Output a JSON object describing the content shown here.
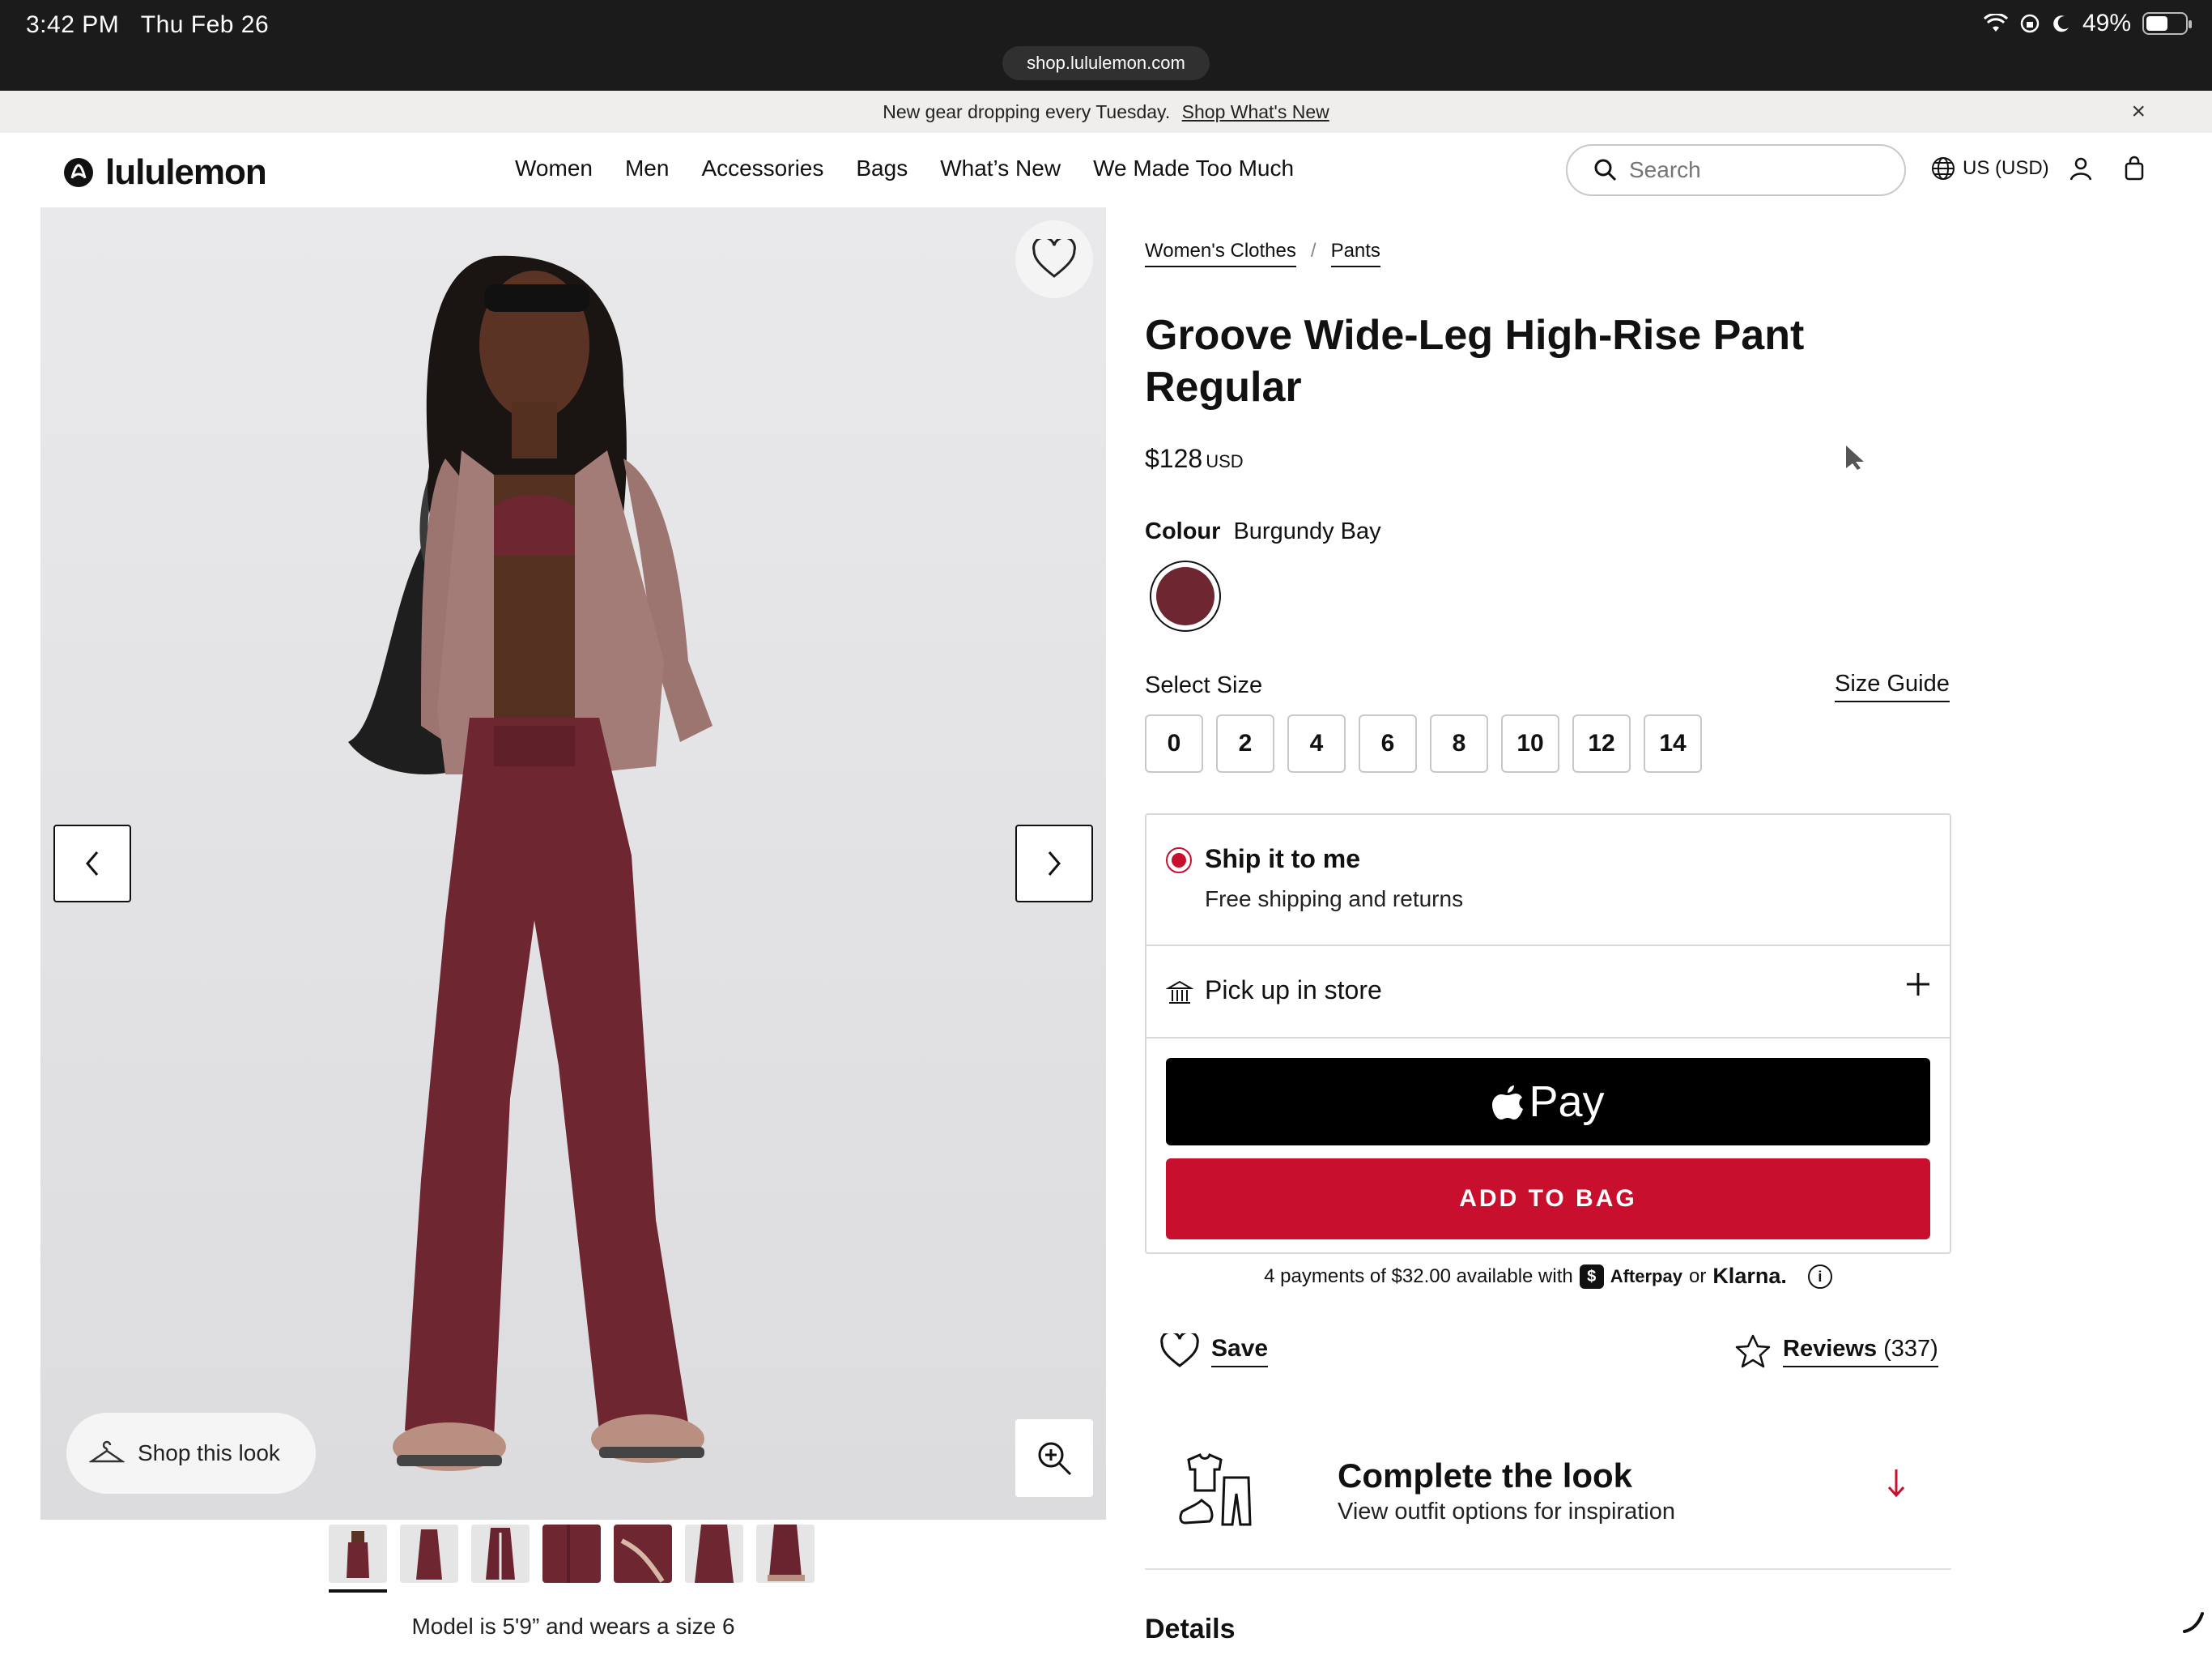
{
  "status_bar": {
    "time": "3:42 PM",
    "date": "Thu Feb 26",
    "battery": "49%",
    "url": "shop.lululemon.com"
  },
  "promo": {
    "text": "New gear dropping every Tuesday.",
    "link": "Shop What's New",
    "close": "×"
  },
  "header": {
    "logo": "lululemon",
    "nav": [
      "Women",
      "Men",
      "Accessories",
      "Bags",
      "What’s New",
      "We Made Too Much"
    ],
    "search_placeholder": "Search",
    "locale": "US (USD)"
  },
  "gallery": {
    "shop_look": "Shop this look",
    "thumb_count": 7,
    "model_note": "Model is 5'9” and wears a size 6"
  },
  "product": {
    "breadcrumbs": [
      "Women's Clothes",
      "Pants"
    ],
    "breadcrumb_sep": "/",
    "title": "Groove Wide-Leg High-Rise Pant Regular",
    "price": "$128",
    "currency": "USD",
    "colour_label": "Colour",
    "colour_name": "Burgundy Bay",
    "swatch_color": "#6e2631",
    "size_label": "Select Size",
    "size_guide": "Size Guide",
    "sizes": [
      "0",
      "2",
      "4",
      "6",
      "8",
      "10",
      "12",
      "14"
    ]
  },
  "fulfilment": {
    "ship_title": "Ship it to me",
    "ship_sub": "Free shipping and returns",
    "pickup_title": "Pick up in store",
    "apple_pay": "Pay",
    "add_to_bag": "ADD TO BAG",
    "accent_color": "#c8102e"
  },
  "installments": {
    "text": "4 payments of $32.00 available with",
    "afterpay": "Afterpay",
    "or": "or",
    "klarna": "Klarna."
  },
  "actions": {
    "save": "Save",
    "reviews": "Reviews",
    "reviews_count": "(337)"
  },
  "complete_look": {
    "title": "Complete the look",
    "subtitle": "View outfit options for inspiration"
  },
  "details_heading": "Details"
}
